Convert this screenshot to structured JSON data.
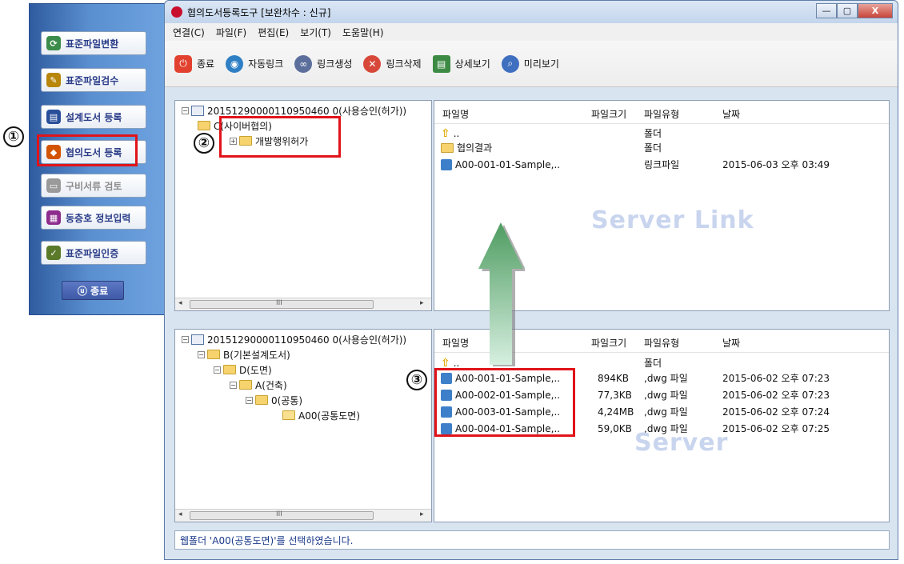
{
  "left_panel": {
    "buttons": [
      {
        "label": "표준파일변환",
        "icon": "convert-icon",
        "color": "#3b8c4a"
      },
      {
        "label": "표준파일검수",
        "icon": "inspect-icon",
        "color": "#b8860b"
      },
      {
        "label": "설계도서 등록",
        "icon": "register-design-icon",
        "color": "#2a4f9a"
      },
      {
        "label": "협의도서 등록",
        "icon": "register-consult-icon",
        "color": "#d35400"
      },
      {
        "label": "구비서류 검토",
        "icon": "review-docs-icon",
        "color": "#9a9a9a"
      },
      {
        "label": "동층호 정보입력",
        "icon": "unit-info-icon",
        "color": "#8e2c8e"
      },
      {
        "label": "표준파일인증",
        "icon": "certify-icon",
        "color": "#5a7a2a"
      }
    ],
    "exit_label": "ⓤ 종료"
  },
  "annotations": {
    "one": "①",
    "two": "②",
    "three": "③"
  },
  "window": {
    "title": "협의도서등록도구 [보완차수 : 신규]",
    "controls": {
      "minimize": "—",
      "maximize": "▢",
      "close": "X"
    }
  },
  "menu": [
    "연결(C)",
    "파일(F)",
    "편집(E)",
    "보기(T)",
    "도움말(H)"
  ],
  "toolbar": [
    {
      "label": "종료",
      "icon": "exit-icon",
      "color": "#e2412f"
    },
    {
      "label": "자동링크",
      "icon": "auto-link-icon",
      "color": "#2f7fc5"
    },
    {
      "label": "링크생성",
      "icon": "create-link-icon",
      "color": "#5c6f9c"
    },
    {
      "label": "링크삭제",
      "icon": "delete-link-icon",
      "color": "#d8483a"
    },
    {
      "label": "상세보기",
      "icon": "detail-view-icon",
      "color": "#3c8a43"
    },
    {
      "label": "미리보기",
      "icon": "preview-icon",
      "color": "#3f6fbf"
    }
  ],
  "server_link_pane": {
    "tree_root": "20151290000110950460 0(사용승인(허가))",
    "tree_items": [
      "C(사이버협의)",
      "개발행위허가"
    ],
    "columns": [
      "파일명",
      "파일크기",
      "파일유형",
      "날짜"
    ],
    "rows": [
      {
        "name": "..",
        "size": "",
        "type": "폴더",
        "date": "",
        "kind": "up"
      },
      {
        "name": "협의결과",
        "size": "",
        "type": "폴더",
        "date": "",
        "kind": "folder"
      },
      {
        "name": "A00-001-01-Sample,..",
        "size": "",
        "type": "링크파일",
        "date": "2015-06-03 오후 03:49",
        "kind": "link"
      }
    ],
    "watermark": "Server Link"
  },
  "server_pane": {
    "tree_root": "20151290000110950460 0(사용승인(허가))",
    "tree_items": [
      "B(기본설계도서)",
      "D(도면)",
      "A(건축)",
      "0(공통)",
      "A00(공통도면)"
    ],
    "columns": [
      "파일명",
      "파일크기",
      "파일유형",
      "날짜"
    ],
    "rows": [
      {
        "name": "..",
        "size": "",
        "type": "폴더",
        "date": "",
        "kind": "up"
      },
      {
        "name": "A00-001-01-Sample,..",
        "size": "894KB",
        "type": ",dwg 파일",
        "date": "2015-06-02 오후 07:23",
        "kind": "link"
      },
      {
        "name": "A00-002-01-Sample,..",
        "size": "77,3KB",
        "type": ",dwg 파일",
        "date": "2015-06-02 오후 07:23",
        "kind": "link"
      },
      {
        "name": "A00-003-01-Sample,..",
        "size": "4,24MB",
        "type": ",dwg 파일",
        "date": "2015-06-02 오후 07:24",
        "kind": "link"
      },
      {
        "name": "A00-004-01-Sample,..",
        "size": "59,0KB",
        "type": ",dwg 파일",
        "date": "2015-06-02 오후 07:25",
        "kind": "link"
      }
    ],
    "watermark": "Server"
  },
  "scroll_grip": "III",
  "status_text": "웹폴더 'A00(공통도면)'를 선택하였습니다."
}
